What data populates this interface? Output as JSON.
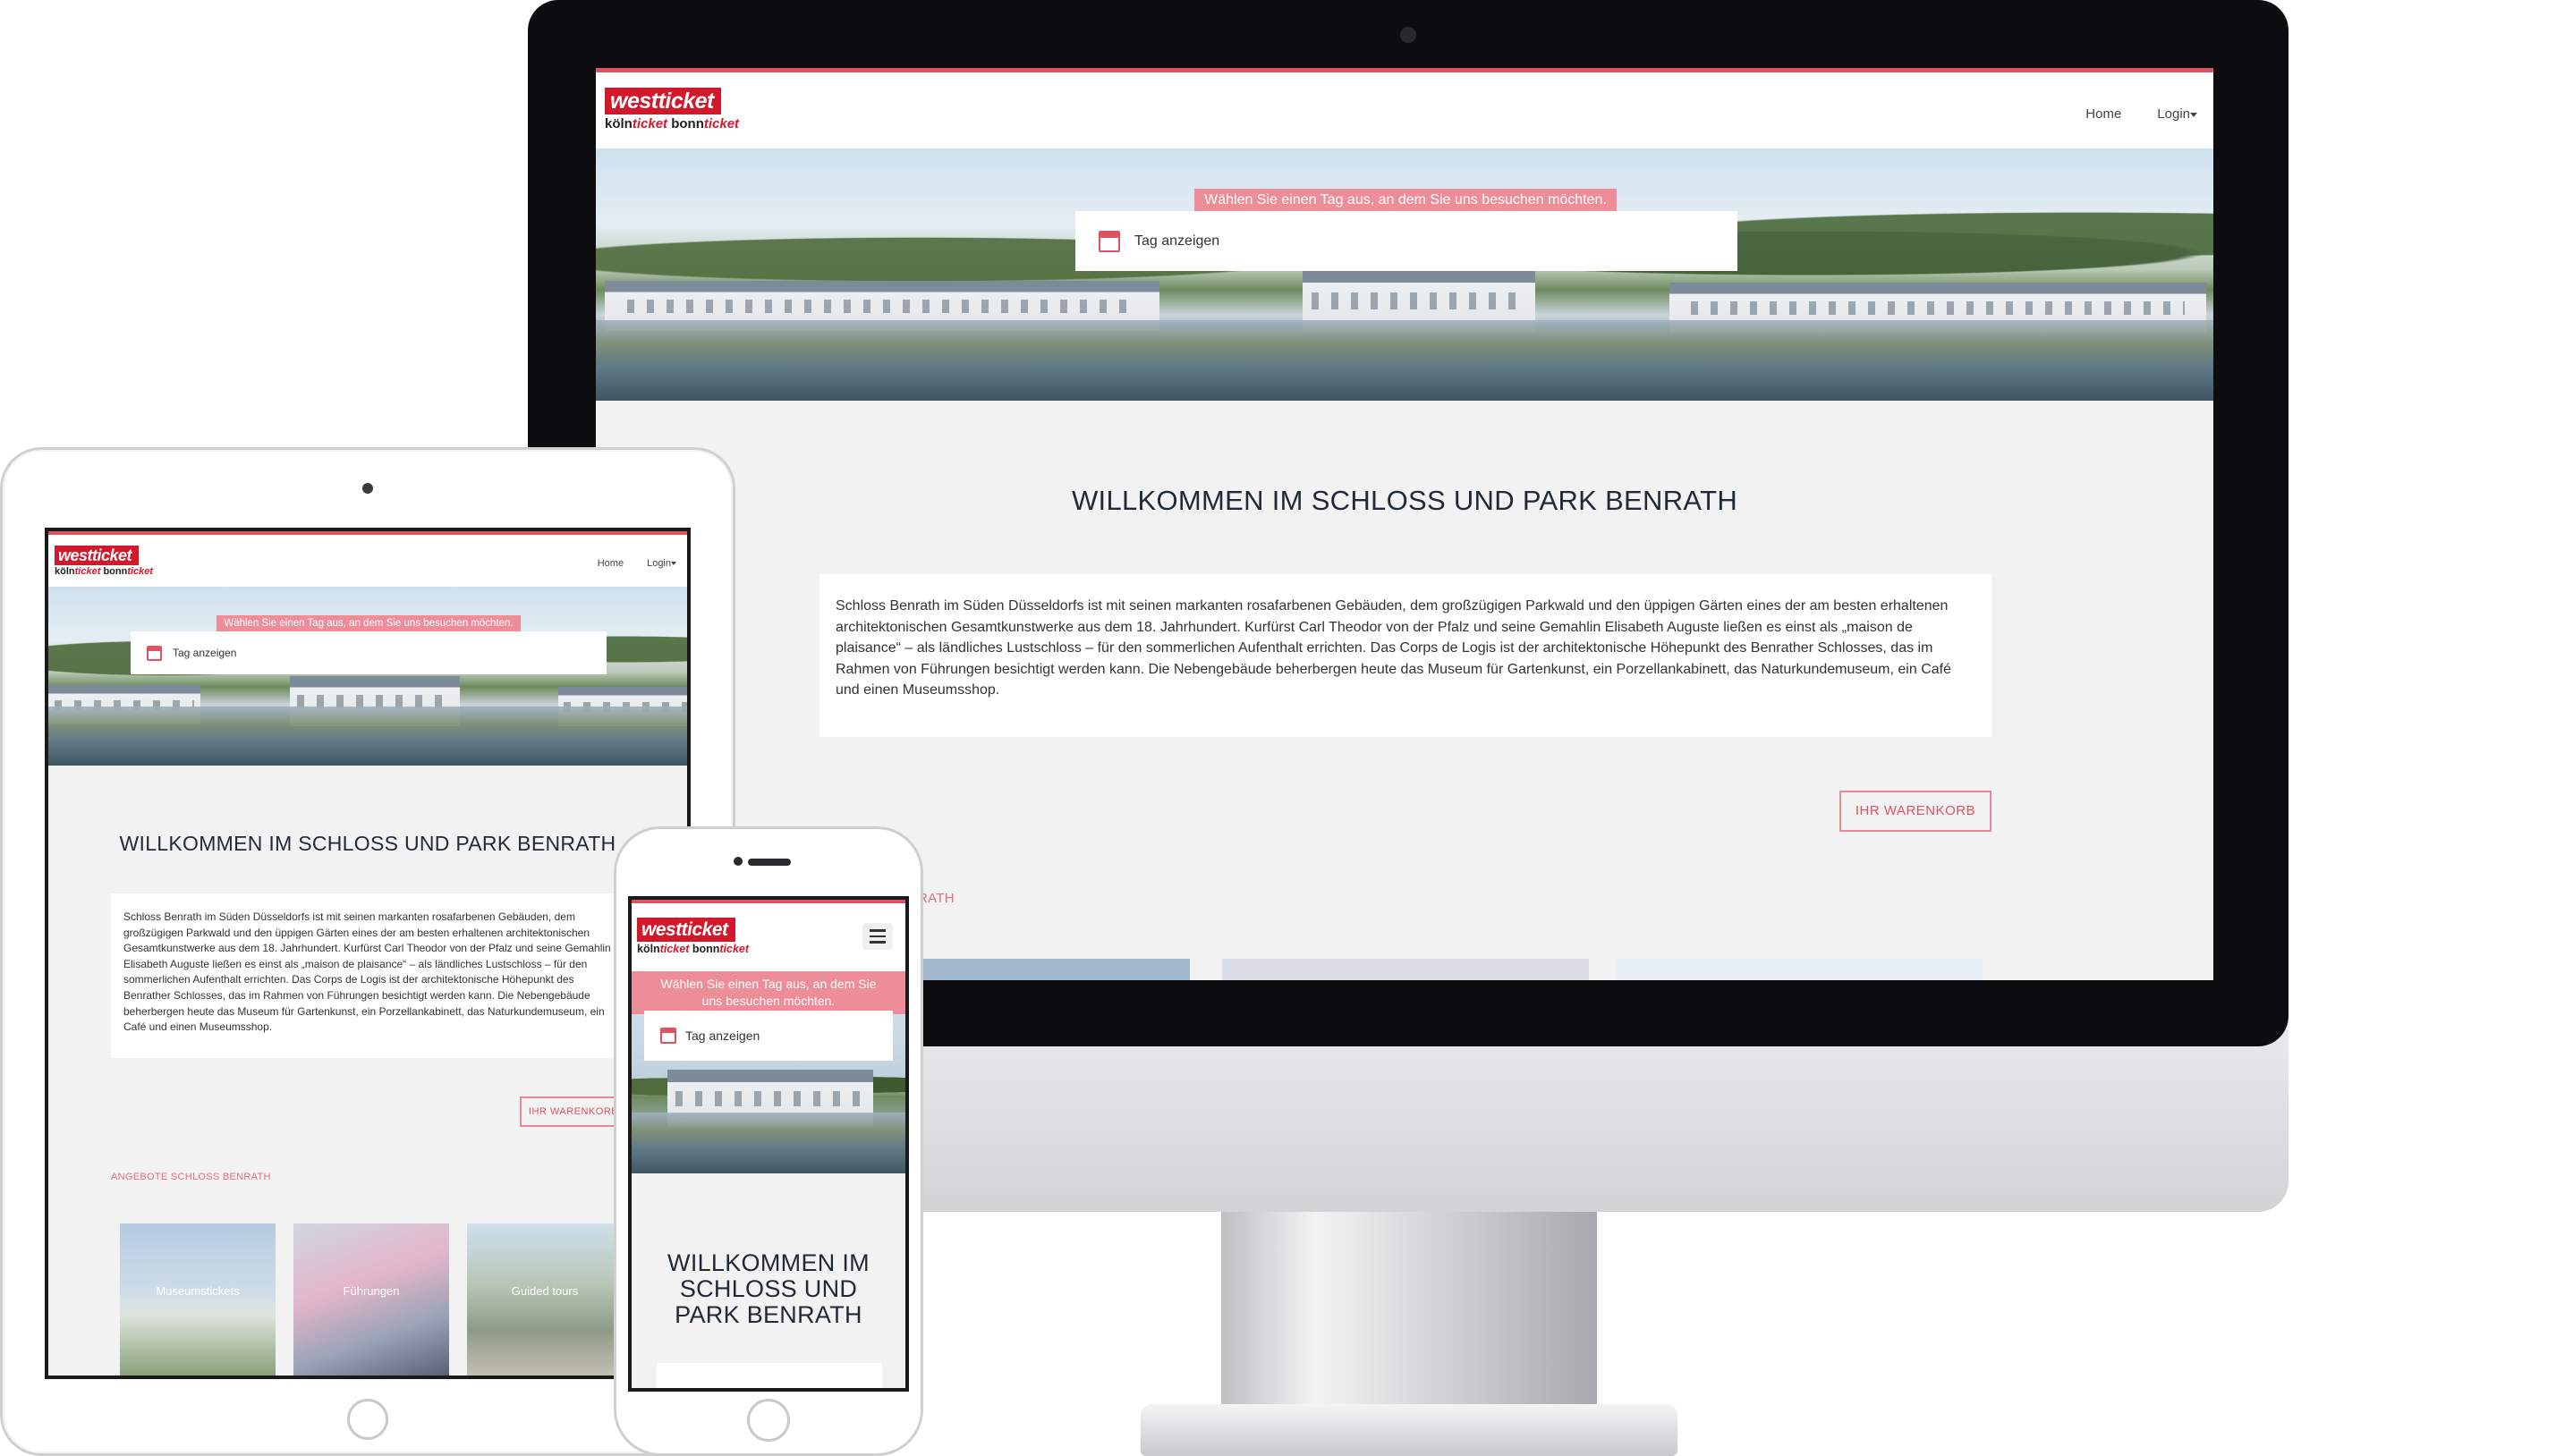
{
  "site": {
    "logo": {
      "top_text": "westticket",
      "bottom_left": "köln",
      "bottom_left_suffix": "ticket",
      "bottom_right": "bonn",
      "bottom_right_suffix": "ticket"
    },
    "nav": {
      "home": "Home",
      "login": "Login"
    },
    "hero": {
      "banner": "Wählen Sie einen Tag aus, an dem Sie uns besuchen möchten.",
      "date_placeholder": "Tag anzeigen",
      "calendar_icon": "calendar-icon"
    },
    "welcome_title": "WILLKOMMEN IM SCHLOSS UND PARK BENRATH",
    "intro_text": "Schloss Benrath im Süden Düsseldorfs ist mit seinen markanten rosafarbenen Gebäuden, dem großzügigen Parkwald und den üppigen Gärten eines der am besten erhaltenen architektonischen Gesamtkunstwerke aus dem 18. Jahrhundert. Kurfürst Carl Theodor von der Pfalz und seine Gemahlin Elisabeth Auguste ließen es einst als „maison de plaisance“ – als ländliches Lustschloss – für den sommerlichen Aufenthalt errichten. Das Corps de Logis ist der architektonische Höhepunkt des Benrather Schlosses, das im Rahmen von Führungen besichtigt werden kann. Die Nebengebäude beherbergen heute das Museum für Gartenkunst, ein Porzellankabinett, das Naturkundemuseum, ein Café und einen Museumsshop.",
    "cart_button": "IHR WARENKORB",
    "offers_label": "ANGEBOTE SCHLOSS BENRATH",
    "offers_label_imac_visible": "SCHLOSS BENRATH",
    "tiles": [
      {
        "label": "Museumstickets"
      },
      {
        "label": "Führungen"
      },
      {
        "label": "Guided tours"
      }
    ]
  },
  "devices": {
    "imac": "desktop",
    "ipad": "tablet",
    "iphone": "phone"
  },
  "colors": {
    "accent": "#e0525f",
    "brand_red": "#d2182b",
    "banner_pink": "#ec8d97",
    "page_bg": "#f2f2f2"
  }
}
